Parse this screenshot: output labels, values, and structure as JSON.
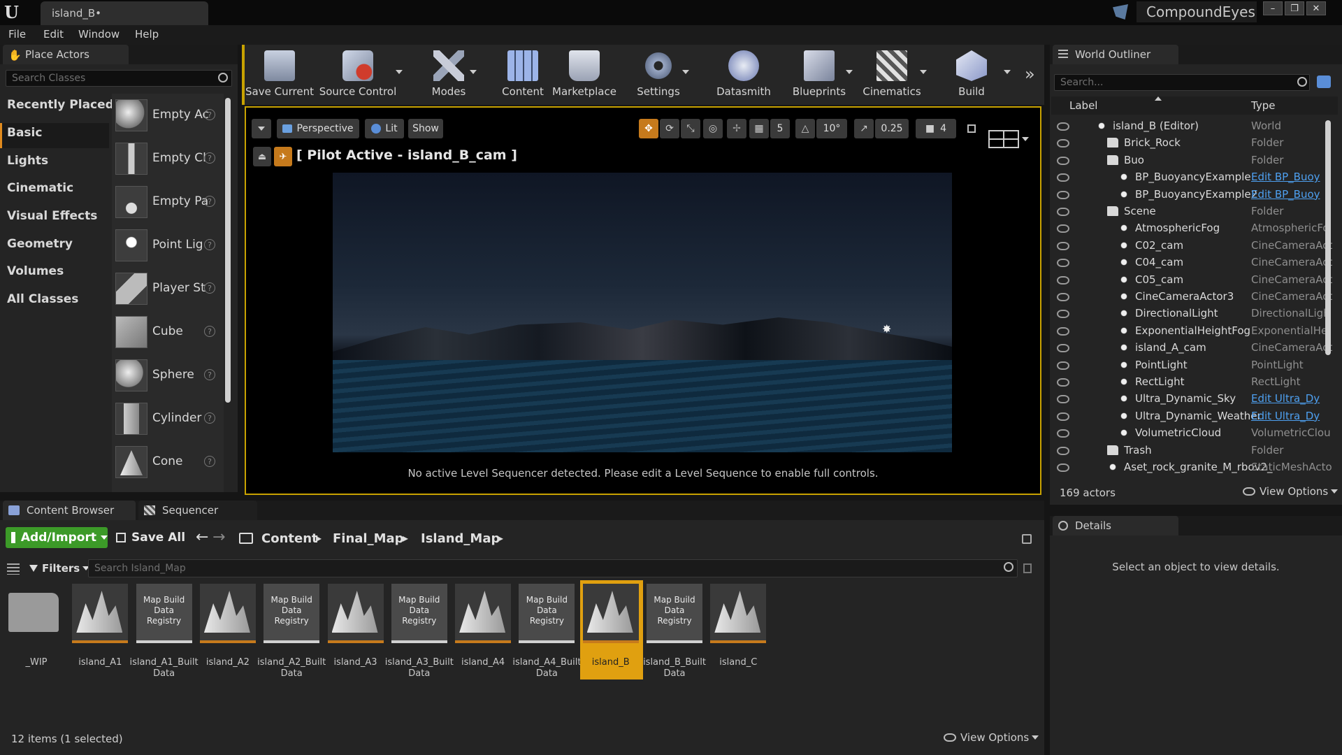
{
  "window": {
    "doc_tab": "island_B•",
    "project": "CompoundEyes",
    "min": "–",
    "max": "❐",
    "close": "✕"
  },
  "menu": [
    "File",
    "Edit",
    "Window",
    "Help"
  ],
  "place_actors": {
    "tab": "Place Actors",
    "search_placeholder": "Search Classes",
    "categories": [
      "Recently Placed",
      "Basic",
      "Lights",
      "Cinematic",
      "Visual Effects",
      "Geometry",
      "Volumes",
      "All Classes"
    ],
    "actors": [
      "Empty Ac",
      "Empty Cl",
      "Empty Pa",
      "Point Lig",
      "Player St",
      "Cube",
      "Sphere",
      "Cylinder",
      "Cone"
    ]
  },
  "toolbar": [
    "Save Current",
    "Source Control",
    "Modes",
    "Content",
    "Marketplace",
    "Settings",
    "Datasmith",
    "Blueprints",
    "Cinematics",
    "Build"
  ],
  "viewport": {
    "perspective": "Perspective",
    "lit": "Lit",
    "show": "Show",
    "grid": "5",
    "angle": "10°",
    "scale": "0.25",
    "cam_speed": "4",
    "pilot": "[ Pilot Active - island_B_cam ]",
    "message": "No active Level Sequencer detected. Please edit a Level Sequence to enable full controls."
  },
  "outliner": {
    "tab": "World Outliner",
    "search_placeholder": "Search...",
    "col_label": "Label",
    "col_type": "Type",
    "rows": [
      {
        "label": "island_B (Editor)",
        "type": "World",
        "link": false
      },
      {
        "label": "Brick_Rock",
        "type": "Folder",
        "link": false
      },
      {
        "label": "Buo",
        "type": "Folder",
        "link": false
      },
      {
        "label": "BP_BuoyancyExample",
        "type": "Edit BP_Buoy",
        "link": true
      },
      {
        "label": "BP_BuoyancyExample2",
        "type": "Edit BP_Buoy",
        "link": true
      },
      {
        "label": "Scene",
        "type": "Folder",
        "link": false
      },
      {
        "label": "AtmosphericFog",
        "type": "AtmosphericFo",
        "link": false
      },
      {
        "label": "C02_cam",
        "type": "CineCameraAct",
        "link": false
      },
      {
        "label": "C04_cam",
        "type": "CineCameraAct",
        "link": false
      },
      {
        "label": "C05_cam",
        "type": "CineCameraAct",
        "link": false
      },
      {
        "label": "CineCameraActor3",
        "type": "CineCameraAct",
        "link": false
      },
      {
        "label": "DirectionalLight",
        "type": "DirectionalLigh",
        "link": false
      },
      {
        "label": "ExponentialHeightFog",
        "type": "ExponentialHei",
        "link": false
      },
      {
        "label": "island_A_cam",
        "type": "CineCameraAct",
        "link": false
      },
      {
        "label": "PointLight",
        "type": "PointLight",
        "link": false
      },
      {
        "label": "RectLight",
        "type": "RectLight",
        "link": false
      },
      {
        "label": "Ultra_Dynamic_Sky",
        "type": "Edit Ultra_Dy",
        "link": true
      },
      {
        "label": "Ultra_Dynamic_Weather",
        "type": "Edit Ultra_Dy",
        "link": true
      },
      {
        "label": "VolumetricCloud",
        "type": "VolumetricClou",
        "link": false
      },
      {
        "label": "Trash",
        "type": "Folder",
        "link": false
      },
      {
        "label": "Aset_rock_granite_M_rbov2_",
        "type": "StaticMeshActo",
        "link": false
      }
    ],
    "count": "169 actors",
    "view_options": "View Options"
  },
  "details": {
    "tab": "Details",
    "empty": "Select an object to view details."
  },
  "content_browser": {
    "tab": "Content Browser",
    "tab2": "Sequencer",
    "add_import": "Add/Import",
    "save_all": "Save All",
    "path": [
      "Content",
      "Final_Map",
      "Island_Map"
    ],
    "filters": "Filters",
    "search_placeholder": "Search Island_Map",
    "assets": [
      {
        "name": "_WIP",
        "kind": "folder"
      },
      {
        "name": "island_A1",
        "kind": "map"
      },
      {
        "name": "island_A1_Built Data",
        "kind": "reg"
      },
      {
        "name": "island_A2",
        "kind": "map"
      },
      {
        "name": "island_A2_Built Data",
        "kind": "reg"
      },
      {
        "name": "island_A3",
        "kind": "map"
      },
      {
        "name": "island_A3_Built Data",
        "kind": "reg"
      },
      {
        "name": "island_A4",
        "kind": "map"
      },
      {
        "name": "island_A4_Built Data",
        "kind": "reg"
      },
      {
        "name": "island_B",
        "kind": "map"
      },
      {
        "name": "island_B_Built Data",
        "kind": "reg"
      },
      {
        "name": "island_C",
        "kind": "map"
      }
    ],
    "reg_label": "Map Build Data Registry",
    "status": "12 items (1 selected)",
    "view_options": "View Options"
  }
}
